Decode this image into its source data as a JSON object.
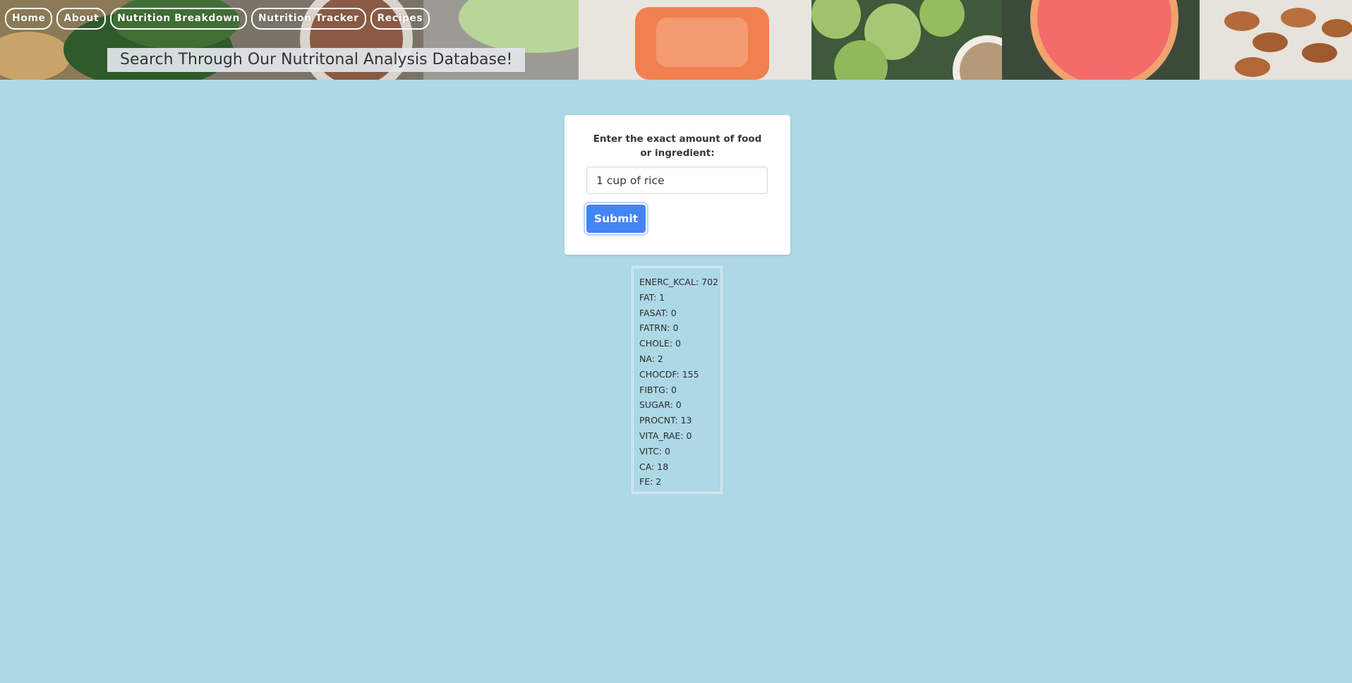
{
  "nav": {
    "items": [
      {
        "label": "Home"
      },
      {
        "label": "About"
      },
      {
        "label": "Nutrition Breakdown"
      },
      {
        "label": "Nutrition Tracker"
      },
      {
        "label": "Recipes"
      }
    ]
  },
  "header": {
    "title": "Search Through Our Nutritonal Analysis Database!"
  },
  "search": {
    "label": "Enter the exact amount of food or ingredient:",
    "value": "1 cup of rice",
    "submit_label": "Submit"
  },
  "results": {
    "items": [
      {
        "text": "ENERC_KCAL: 702"
      },
      {
        "text": "FAT: 1"
      },
      {
        "text": "FASAT: 0"
      },
      {
        "text": "FATRN: 0"
      },
      {
        "text": "CHOLE: 0"
      },
      {
        "text": "NA: 2"
      },
      {
        "text": "CHOCDF: 155"
      },
      {
        "text": "FIBTG: 0"
      },
      {
        "text": "SUGAR: 0"
      },
      {
        "text": "PROCNT: 13"
      },
      {
        "text": "VITA_RAE: 0"
      },
      {
        "text": "VITC: 0"
      },
      {
        "text": "CA: 18"
      },
      {
        "text": "FE: 2"
      }
    ]
  },
  "colors": {
    "page_background": "#add8e6",
    "submit_button": "#4285f4",
    "card_background": "#ffffff"
  }
}
